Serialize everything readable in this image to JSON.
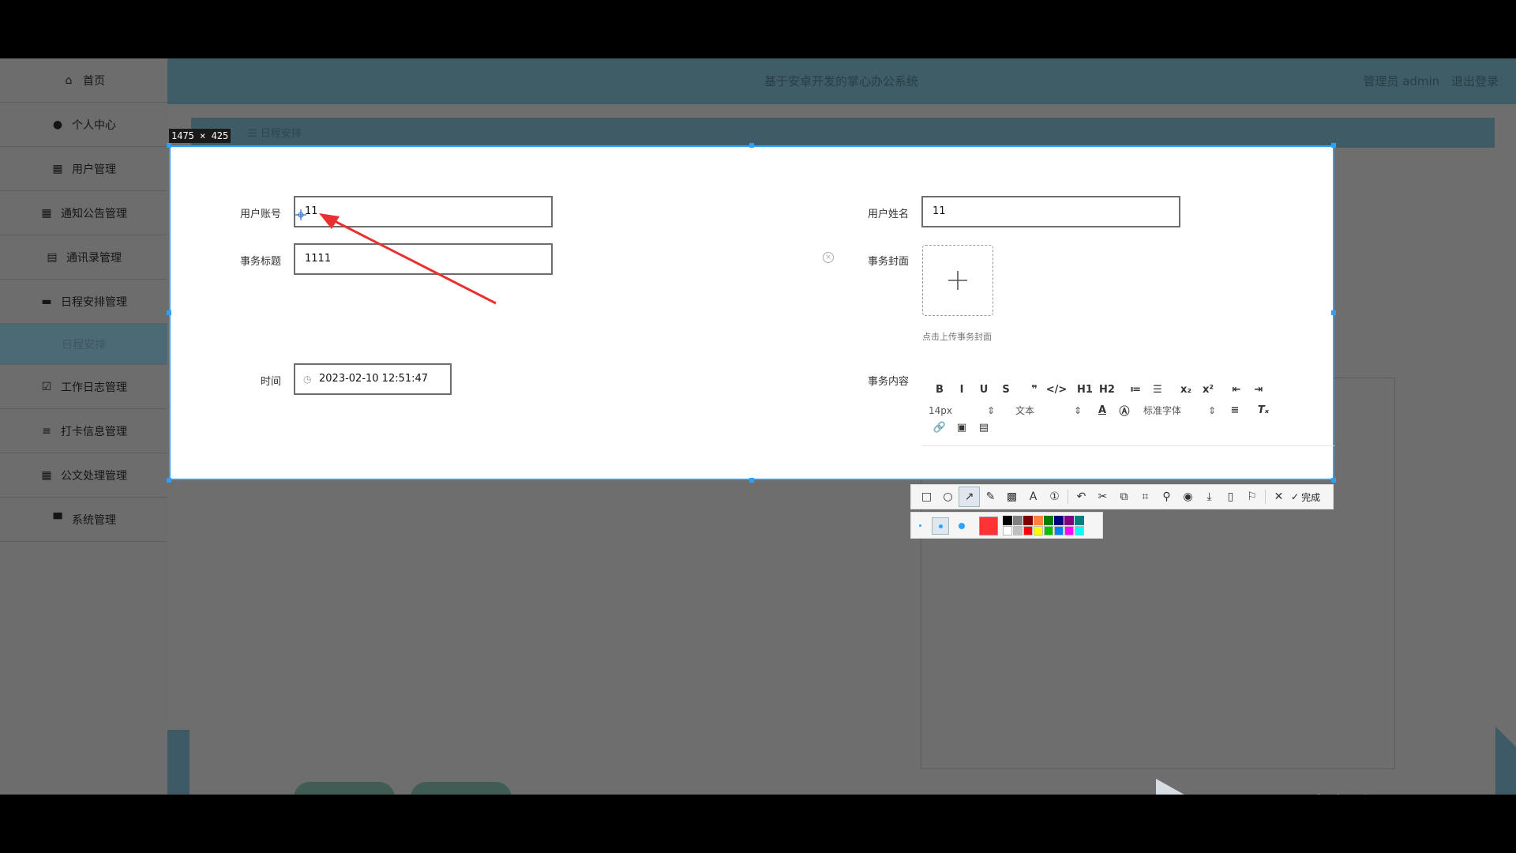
{
  "app": {
    "title": "基于安卓开发的掌心办公系统",
    "user_label": "管理员 admin",
    "logout_label": "退出登录"
  },
  "sidebar": {
    "items": [
      {
        "label": "首页",
        "icon": "home-icon"
      },
      {
        "label": "个人中心",
        "icon": "person-icon"
      },
      {
        "label": "用户管理",
        "icon": "grid-icon"
      },
      {
        "label": "通知公告管理",
        "icon": "grid-icon"
      },
      {
        "label": "通讯录管理",
        "icon": "clipboard-icon"
      },
      {
        "label": "日程安排管理",
        "icon": "briefcase-icon"
      },
      {
        "label": "日程安排",
        "icon": "",
        "sub": true
      },
      {
        "label": "工作日志管理",
        "icon": "checklist-icon"
      },
      {
        "label": "打卡信息管理",
        "icon": "list-icon"
      },
      {
        "label": "公文处理管理",
        "icon": "grid-icon"
      },
      {
        "label": "系统管理",
        "icon": "monitor-icon"
      }
    ]
  },
  "breadcrumb": {
    "current": "日程安排"
  },
  "capture": {
    "size_label": "1475 × 425"
  },
  "form": {
    "account_label": "用户账号",
    "account_value": "11",
    "name_label": "用户姓名",
    "name_value": "11",
    "title_label": "事务标题",
    "title_value": "1111",
    "cover_label": "事务封面",
    "cover_hint": "点击上传事务封面",
    "time_label": "时间",
    "time_value": "2023-02-10 12:51:47",
    "content_label": "事务内容"
  },
  "editor": {
    "font_size": "14px",
    "block_type": "文本",
    "font_family": "标准字体",
    "buttons_row1": [
      "B",
      "I",
      "U",
      "S",
      "❞",
      "</>",
      "H1",
      "H2",
      "≔",
      "☰",
      "x₂",
      "x²",
      "⇤",
      "⇥"
    ]
  },
  "snap_toolbar": {
    "done_label": "完成",
    "colors": {
      "selected": "#ff3333",
      "palette_top": [
        "#000000",
        "#808080",
        "#800000",
        "#ff8040",
        "#008000",
        "#000080",
        "#800080",
        "#008080"
      ],
      "palette_bottom": [
        "#ffffff",
        "#c0c0c0",
        "#ff0000",
        "#ffff00",
        "#00c000",
        "#0080ff",
        "#ff00ff",
        "#00ffff"
      ]
    }
  },
  "watermark": {
    "text": "eV剪辑"
  }
}
